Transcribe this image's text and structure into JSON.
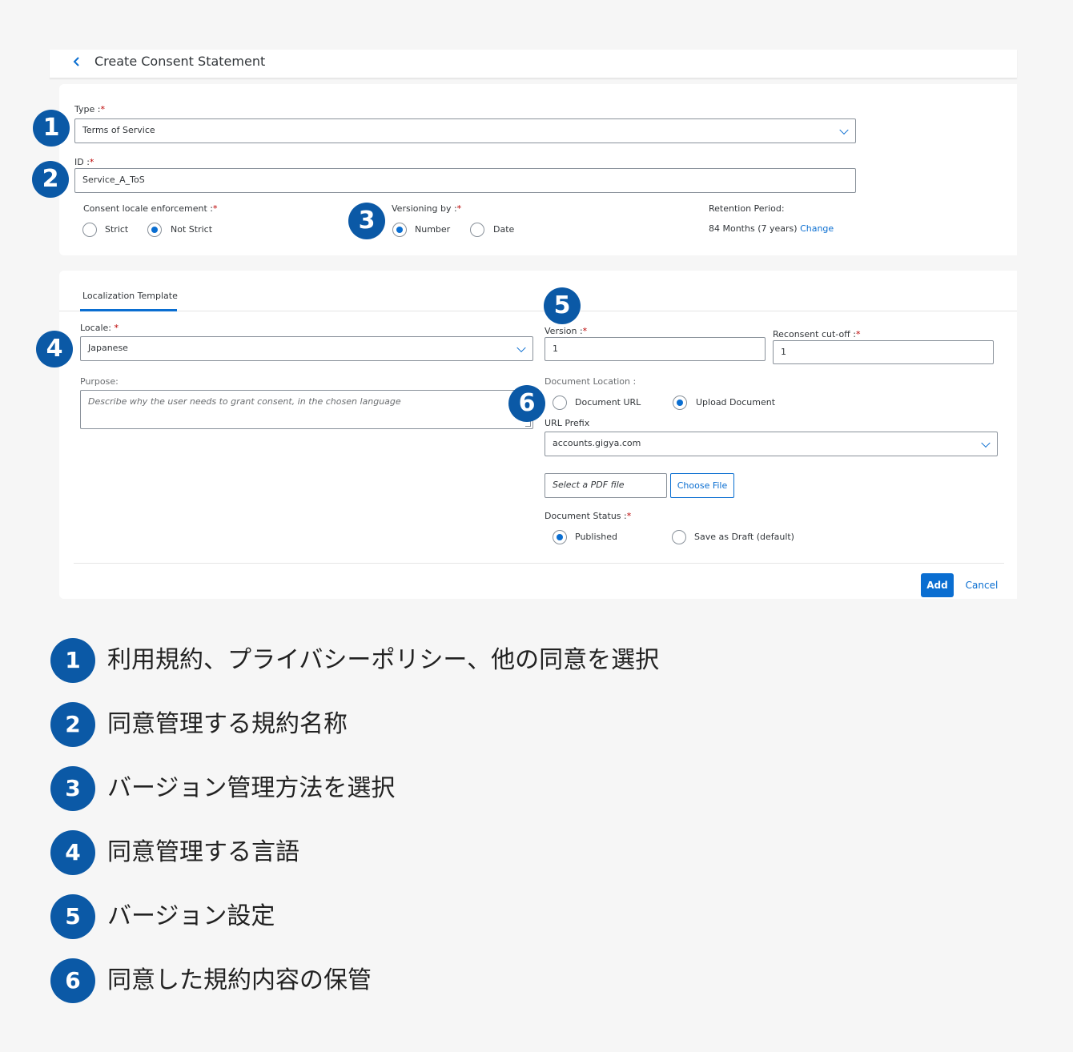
{
  "header": {
    "back_icon": "chevron-left-icon",
    "title": "Create Consent Statement"
  },
  "consent": {
    "type_label": "Type :",
    "type_value": "Terms of Service",
    "id_label": "ID :",
    "id_value": "Service_A_ToS",
    "enforcement_label": "Consent locale enforcement :",
    "enforcement_options": [
      "Strict",
      "Not Strict"
    ],
    "enforcement_selected": "Not Strict",
    "versioning_label": "Versioning by :",
    "versioning_options": [
      "Number",
      "Date"
    ],
    "versioning_selected": "Number",
    "retention_label": "Retention Period:",
    "retention_value": "84 Months (7 years)",
    "retention_change": "Change",
    "required_mark": "*"
  },
  "localization": {
    "tab_label": "Localization Template",
    "locale_label": "Locale:",
    "locale_value": "Japanese",
    "purpose_label": "Purpose:",
    "purpose_placeholder": "Describe why the user needs to grant consent, in the chosen language",
    "version_label": "Version :",
    "version_value": "1",
    "reconsent_label": "Reconsent cut-off :",
    "reconsent_value": "1",
    "doc_location_label": "Document Location :",
    "doc_location_options": [
      "Document URL",
      "Upload Document"
    ],
    "doc_location_selected": "Upload Document",
    "url_prefix_label": "URL Prefix",
    "url_prefix_value": "accounts.gigya.com",
    "file_placeholder": "Select a PDF file",
    "choose_file_label": "Choose File",
    "doc_status_label": "Document Status :",
    "doc_status_options": [
      "Published",
      "Save as Draft (default)"
    ],
    "doc_status_selected": "Published"
  },
  "actions": {
    "add_label": "Add",
    "cancel_label": "Cancel"
  },
  "badges": [
    "1",
    "2",
    "3",
    "4",
    "5",
    "6"
  ],
  "legend": [
    {
      "num": "1",
      "text": "利用規約、プライバシーポリシー、他の同意を選択"
    },
    {
      "num": "2",
      "text": "同意管理する規約名称"
    },
    {
      "num": "3",
      "text": "バージョン管理方法を選択"
    },
    {
      "num": "4",
      "text": "同意管理する言語"
    },
    {
      "num": "5",
      "text": "バージョン設定"
    },
    {
      "num": "6",
      "text": "同意した規約内容の保管"
    }
  ],
  "colors": {
    "accent": "#0a6ed1",
    "badge": "#0b59a6",
    "required": "#bb0000",
    "background": "#f6f6f6"
  }
}
